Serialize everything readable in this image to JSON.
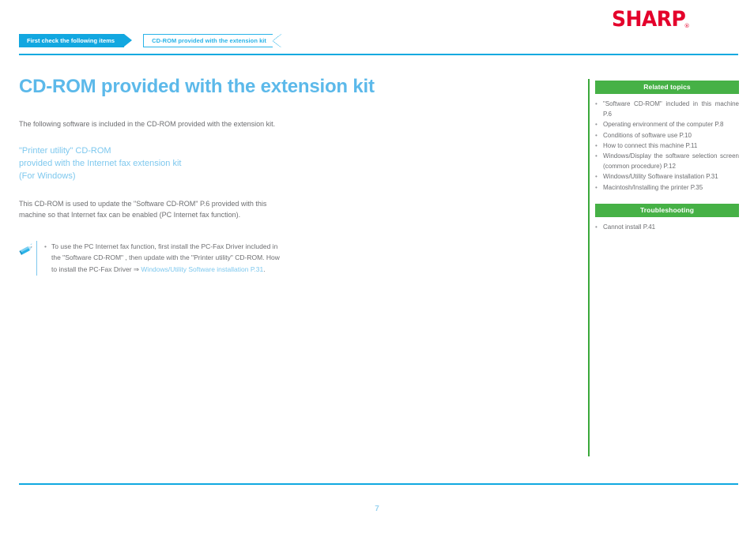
{
  "brand": {
    "logo_text": "SHARP",
    "registered_mark": "®"
  },
  "breadcrumb": {
    "items": [
      {
        "label": "First check the following items",
        "state": "active"
      },
      {
        "label": "CD-ROM provided with the extension kit",
        "state": "current"
      }
    ]
  },
  "main": {
    "title": "CD-ROM provided with the extension kit",
    "intro": "The following software is included in the CD-ROM provided with the extension kit.",
    "subheading": "\"Printer utility\" CD-ROM\nprovided with the Internet fax extension kit\n(For Windows)",
    "paragraph": "This CD-ROM is used to update the \"Software CD-ROM\" P.6  provided with this machine so that Internet fax can be enabled (PC Internet fax function).",
    "note": {
      "icon_name": "pencil-note-icon",
      "bullet": "•",
      "text_before_link": "To use the PC Internet fax function, first install the PC-Fax Driver included in the \"Software CD-ROM\" , then update with the \"Printer utility\" CD-ROM. How to install the PC-Fax Driver ⇒ ",
      "link_text": "Windows/Utility Software installation P.31",
      "text_after_link": "."
    }
  },
  "sidebar": {
    "related": {
      "header": "Related topics",
      "bullet": "•",
      "items": [
        "\"Software CD-ROM\" included in this machine P.6",
        "Operating environment of the computer P.8",
        "Conditions of software use P.10",
        "How to connect this machine P.11",
        "Windows/Display the software selection screen (common procedure) P.12",
        "Windows/Utility Software installation P.31",
        "Macintosh/Installing the printer P.35"
      ]
    },
    "troubleshooting": {
      "header": "Troubleshooting",
      "bullet": "•",
      "items": [
        "Cannot install P.41"
      ]
    }
  },
  "footer": {
    "page_number": "7"
  },
  "colors": {
    "brand_red": "#e4002b",
    "accent_blue": "#12a7e0",
    "title_blue": "#5cb9ea",
    "light_blue": "#7ec8ee",
    "panel_green": "#46b146",
    "divider_green": "#3aa83a",
    "body_gray": "#6d6e71"
  }
}
